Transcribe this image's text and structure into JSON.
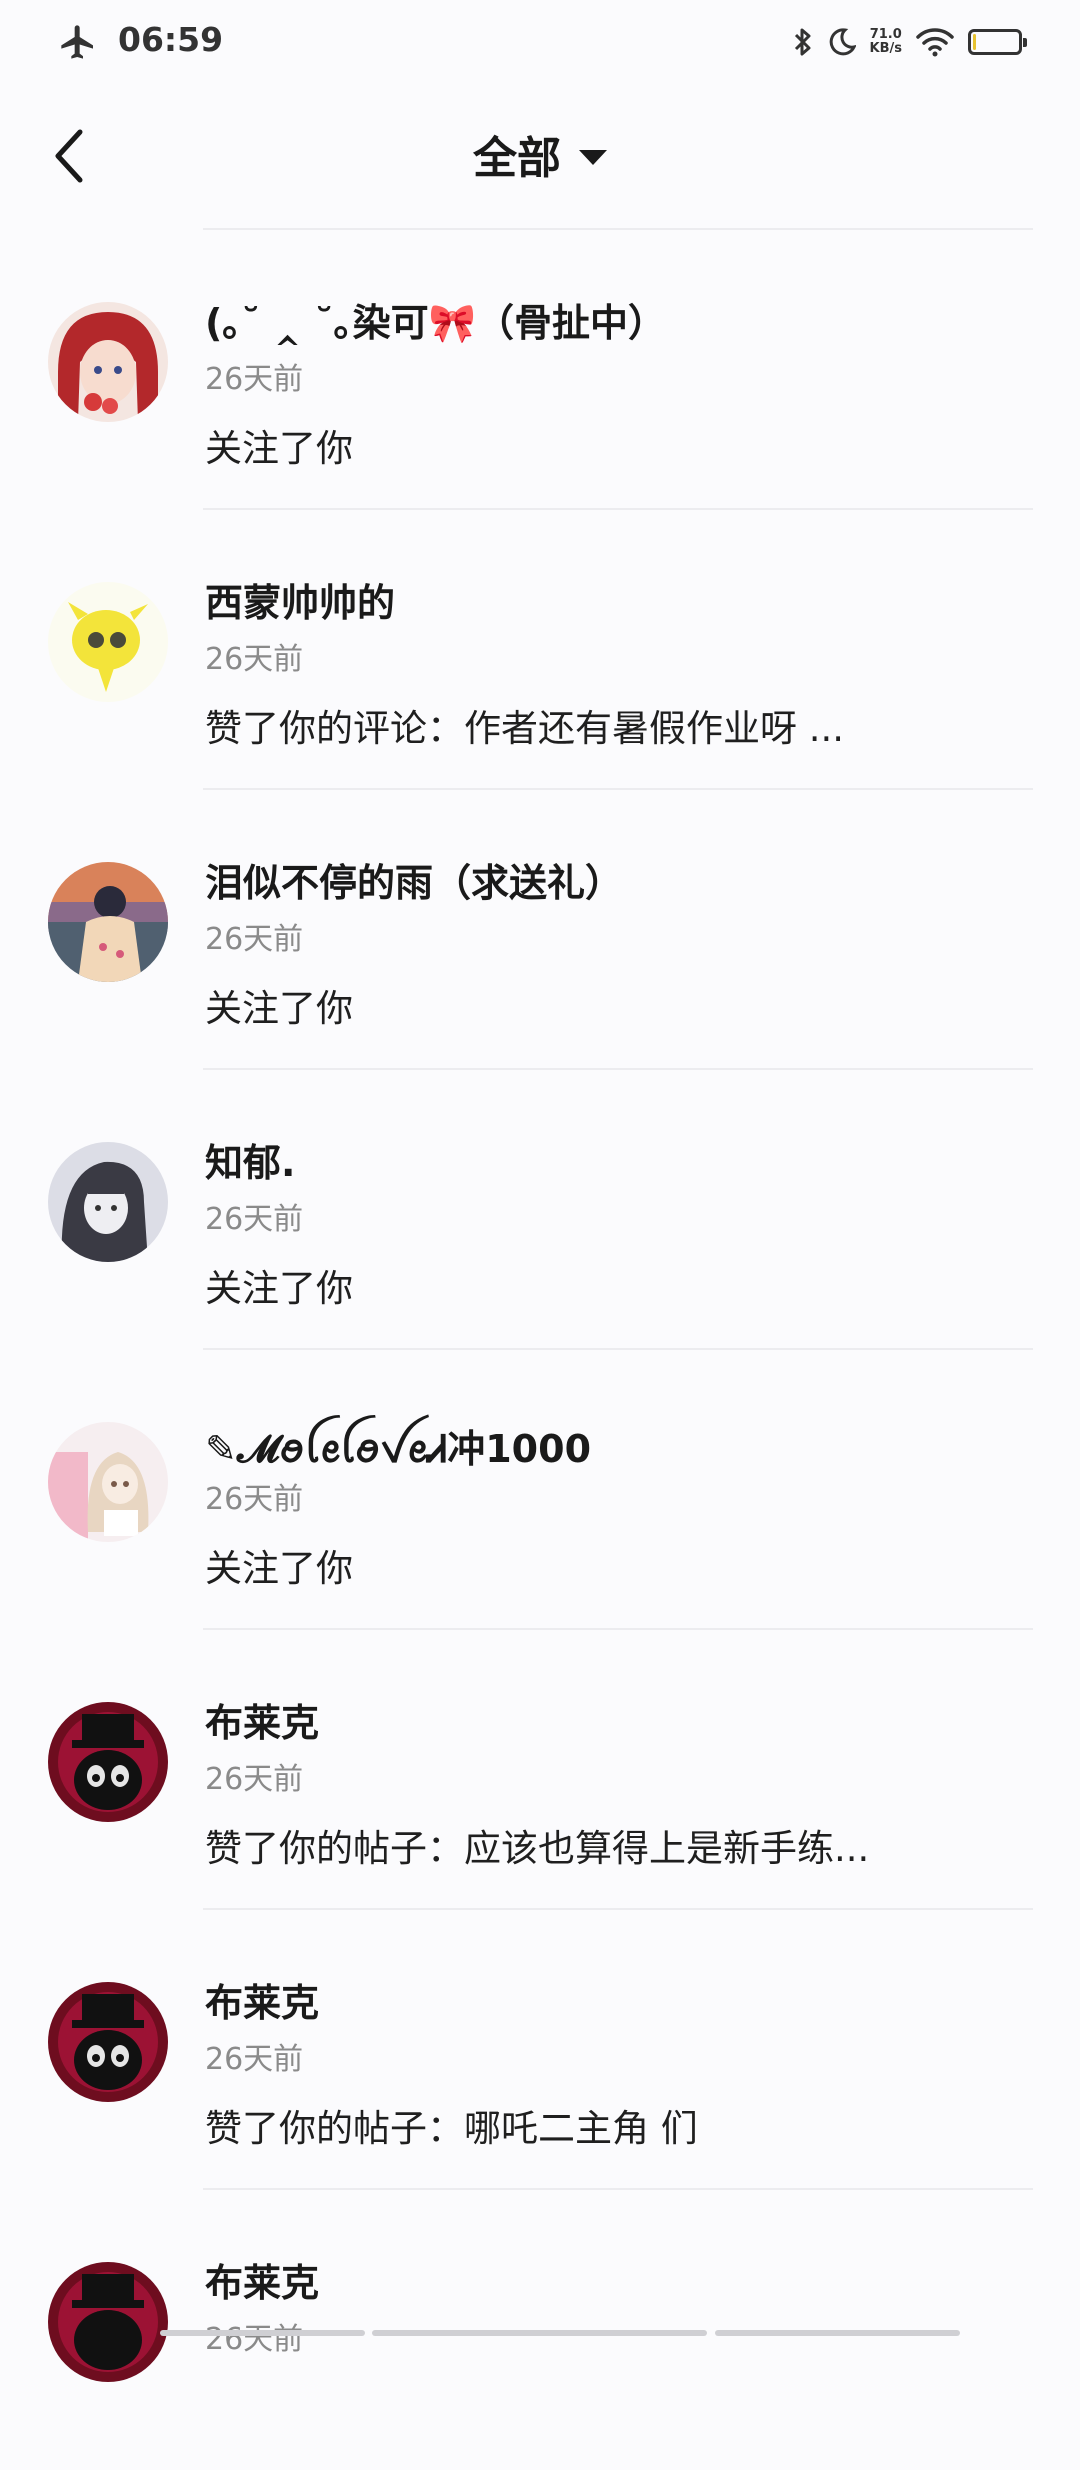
{
  "status_bar": {
    "time": "06:59",
    "net_speed_value": "71.0",
    "net_speed_unit": "KB/s",
    "icons": [
      "airplane-icon",
      "bluetooth-icon",
      "moon-icon",
      "wifi-icon",
      "battery-icon"
    ]
  },
  "header": {
    "title": "全部"
  },
  "notifications": [
    {
      "name": "(｡˘ ‸ ˘｡染可🎀（骨扯中）",
      "time": "26天前",
      "content": "关注了你",
      "avatar_color": "#b3282b"
    },
    {
      "name": "西蒙帅帅的",
      "time": "26天前",
      "content": "赞了你的评论：作者还有暑假作业呀 ...",
      "avatar_color": "#f3e43a"
    },
    {
      "name": "泪似不停的雨（求送礼）",
      "time": "26天前",
      "content": "关注了你",
      "avatar_color": "#c9a36a"
    },
    {
      "name": "知郁.",
      "time": "26天前",
      "content": "关注了你",
      "avatar_color": "#9a9aa6"
    },
    {
      "name": "✎𝓜ꪮꪶꫀꪶꪮꪜꫀᏗ冲1000",
      "time": "26天前",
      "content": "关注了你",
      "avatar_color": "#efd9d6"
    },
    {
      "name": "布莱克",
      "time": "26天前",
      "content": "赞了你的帖子：应该也算得上是新手练...",
      "avatar_color": "#6e0d1f"
    },
    {
      "name": "布莱克",
      "time": "26天前",
      "content": "赞了你的帖子：哪吒二主角 们",
      "avatar_color": "#6e0d1f"
    },
    {
      "name": "布莱克",
      "time": "26天前",
      "content": "",
      "avatar_color": "#6e0d1f"
    }
  ]
}
